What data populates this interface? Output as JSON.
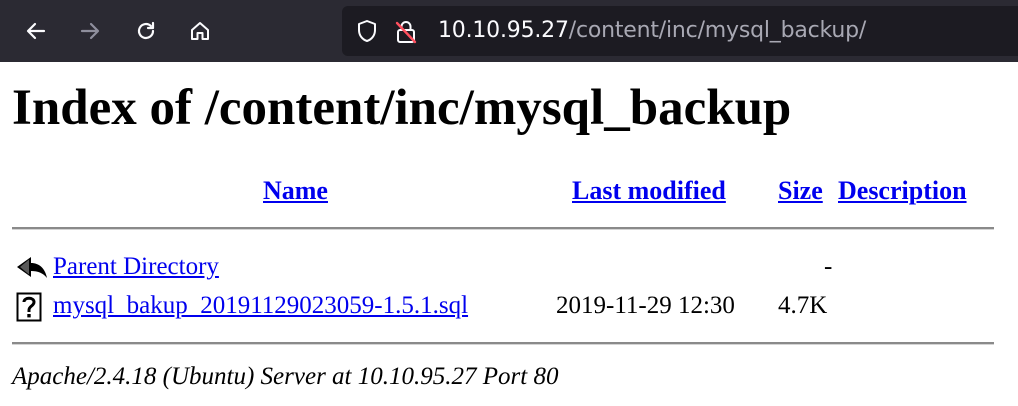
{
  "browser": {
    "url_host": "10.10.95.27",
    "url_path": "/content/inc/mysql_backup/",
    "icons": [
      "back-arrow-icon",
      "forward-arrow-icon",
      "reload-icon",
      "home-icon",
      "shield-icon",
      "insecure-lock-icon"
    ]
  },
  "page": {
    "title": "Index of /content/inc/mysql_backup",
    "columns": {
      "name": "Name",
      "last_modified": "Last modified",
      "size": "Size",
      "description": "Description"
    },
    "rows": [
      {
        "icon": "back-icon",
        "name": "Parent Directory",
        "last_modified": "",
        "size": "-",
        "description": ""
      },
      {
        "icon": "unknown-file-icon",
        "name": "mysql_bakup_20191129023059-1.5.1.sql",
        "last_modified": "2019-11-29 12:30",
        "size": "4.7K",
        "description": ""
      }
    ],
    "footer": "Apache/2.4.18 (Ubuntu) Server at 10.10.95.27 Port 80"
  }
}
